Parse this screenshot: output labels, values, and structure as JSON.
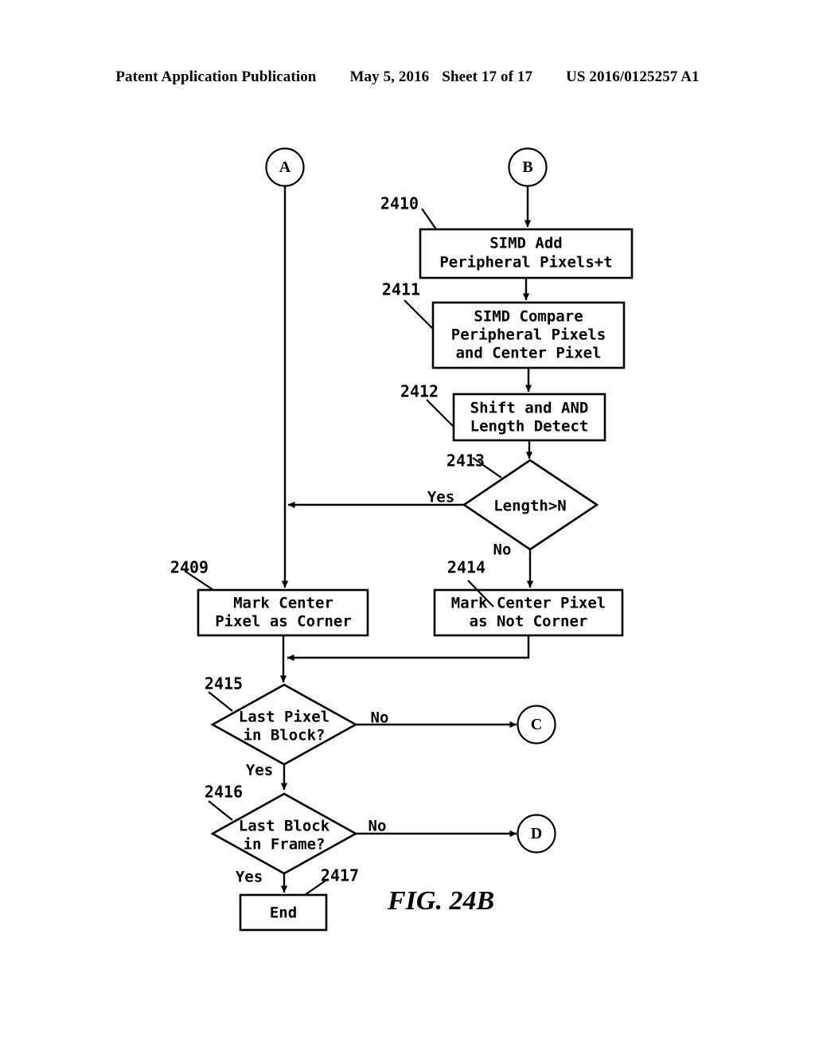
{
  "header": {
    "publication": "Patent Application Publication",
    "date": "May 5, 2016",
    "sheet": "Sheet 17 of 17",
    "number": "US 2016/0125257 A1"
  },
  "figure": {
    "caption": "FIG. 24B",
    "connectors": {
      "a": "A",
      "b": "B",
      "c": "C",
      "d": "D"
    },
    "nodes": {
      "n2409": {
        "ref": "2409",
        "lines": [
          "Mark Center",
          "Pixel as Corner"
        ],
        "shape": "process"
      },
      "n2410": {
        "ref": "2410",
        "lines": [
          "SIMD Add",
          "Peripheral Pixels+t"
        ],
        "shape": "process"
      },
      "n2411": {
        "ref": "2411",
        "lines": [
          "SIMD Compare",
          "Peripheral Pixels",
          "and Center Pixel"
        ],
        "shape": "process"
      },
      "n2412": {
        "ref": "2412",
        "lines": [
          "Shift and AND",
          "Length Detect"
        ],
        "shape": "process"
      },
      "n2413": {
        "ref": "2413",
        "lines": [
          "Length>N"
        ],
        "shape": "decision"
      },
      "n2414": {
        "ref": "2414",
        "lines": [
          "Mark Center Pixel",
          "as Not Corner"
        ],
        "shape": "process"
      },
      "n2415": {
        "ref": "2415",
        "lines": [
          "Last Pixel",
          "in Block?"
        ],
        "shape": "decision"
      },
      "n2416": {
        "ref": "2416",
        "lines": [
          "Last Block",
          "in Frame?"
        ],
        "shape": "decision"
      },
      "n2417": {
        "ref": "2417",
        "lines": [
          "End"
        ],
        "shape": "terminator"
      }
    },
    "edge_labels": {
      "len_yes": "Yes",
      "len_no": "No",
      "pixel_no": "No",
      "pixel_yes": "Yes",
      "block_no": "No",
      "block_yes": "Yes"
    }
  }
}
